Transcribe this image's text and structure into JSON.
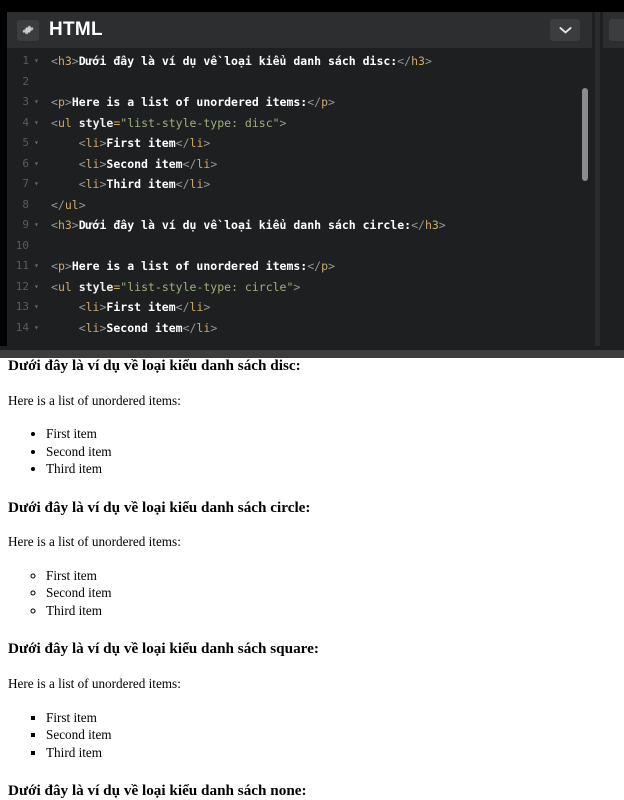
{
  "window": {
    "background": "#000000"
  },
  "editor": {
    "title": "HTML",
    "gear_icon": "gear-icon",
    "collapse_icon": "chevron-down-icon",
    "theme": {
      "header_bg": "#2c2e2f",
      "code_bg": "#1d1f20",
      "tag_color": "#d0a96a",
      "string_color": "#9fb07a",
      "text_color": "#ffffff",
      "punct_color": "#969896",
      "line_number_color": "#5b5c5d"
    },
    "lines": [
      {
        "n": "1",
        "fold": "▾",
        "tokens": [
          {
            "c": "punc",
            "t": "<"
          },
          {
            "c": "tag",
            "t": "h3"
          },
          {
            "c": "punc",
            "t": ">"
          },
          {
            "c": "text",
            "t": "Dưới đây là ví dụ về loại kiểu danh sách disc:"
          },
          {
            "c": "punc",
            "t": "</"
          },
          {
            "c": "tag",
            "t": "h3"
          },
          {
            "c": "punc",
            "t": ">"
          }
        ]
      },
      {
        "n": "2",
        "fold": "",
        "tokens": []
      },
      {
        "n": "3",
        "fold": "▾",
        "tokens": [
          {
            "c": "punc",
            "t": "<"
          },
          {
            "c": "tag",
            "t": "p"
          },
          {
            "c": "punc",
            "t": ">"
          },
          {
            "c": "text",
            "t": "Here is a list of unordered items:"
          },
          {
            "c": "punc",
            "t": "</"
          },
          {
            "c": "tag",
            "t": "p"
          },
          {
            "c": "punc",
            "t": ">"
          }
        ]
      },
      {
        "n": "4",
        "fold": "▾",
        "tokens": [
          {
            "c": "punc",
            "t": "<"
          },
          {
            "c": "tag",
            "t": "ul"
          },
          {
            "c": "punc",
            "t": " "
          },
          {
            "c": "attr",
            "t": "style"
          },
          {
            "c": "eq",
            "t": "="
          },
          {
            "c": "str",
            "t": "\"list-style-type: disc\""
          },
          {
            "c": "punc",
            "t": ">"
          }
        ]
      },
      {
        "n": "5",
        "fold": "▾",
        "tokens": [
          {
            "c": "punc",
            "t": "    <"
          },
          {
            "c": "tag",
            "t": "li"
          },
          {
            "c": "punc",
            "t": ">"
          },
          {
            "c": "text",
            "t": "First item"
          },
          {
            "c": "punc",
            "t": "</"
          },
          {
            "c": "tag",
            "t": "li"
          },
          {
            "c": "punc",
            "t": ">"
          }
        ]
      },
      {
        "n": "6",
        "fold": "▾",
        "tokens": [
          {
            "c": "punc",
            "t": "    <"
          },
          {
            "c": "tag",
            "t": "li"
          },
          {
            "c": "punc",
            "t": ">"
          },
          {
            "c": "text",
            "t": "Second item"
          },
          {
            "c": "punc",
            "t": "</"
          },
          {
            "c": "tag",
            "t": "li"
          },
          {
            "c": "punc",
            "t": ">"
          }
        ]
      },
      {
        "n": "7",
        "fold": "▾",
        "tokens": [
          {
            "c": "punc",
            "t": "    <"
          },
          {
            "c": "tag",
            "t": "li"
          },
          {
            "c": "punc",
            "t": ">"
          },
          {
            "c": "text",
            "t": "Third item"
          },
          {
            "c": "punc",
            "t": "</"
          },
          {
            "c": "tag",
            "t": "li"
          },
          {
            "c": "punc",
            "t": ">"
          }
        ]
      },
      {
        "n": "8",
        "fold": "",
        "tokens": [
          {
            "c": "punc",
            "t": "</"
          },
          {
            "c": "tag",
            "t": "ul"
          },
          {
            "c": "punc",
            "t": ">"
          }
        ]
      },
      {
        "n": "9",
        "fold": "▾",
        "tokens": [
          {
            "c": "punc",
            "t": "<"
          },
          {
            "c": "tag",
            "t": "h3"
          },
          {
            "c": "punc",
            "t": ">"
          },
          {
            "c": "text",
            "t": "Dưới đây là ví dụ về loại kiểu danh sách circle:"
          },
          {
            "c": "punc",
            "t": "</"
          },
          {
            "c": "tag",
            "t": "h3"
          },
          {
            "c": "punc",
            "t": ">"
          }
        ]
      },
      {
        "n": "10",
        "fold": "",
        "tokens": []
      },
      {
        "n": "11",
        "fold": "▾",
        "tokens": [
          {
            "c": "punc",
            "t": "<"
          },
          {
            "c": "tag",
            "t": "p"
          },
          {
            "c": "punc",
            "t": ">"
          },
          {
            "c": "text",
            "t": "Here is a list of unordered items:"
          },
          {
            "c": "punc",
            "t": "</"
          },
          {
            "c": "tag",
            "t": "p"
          },
          {
            "c": "punc",
            "t": ">"
          }
        ]
      },
      {
        "n": "12",
        "fold": "▾",
        "tokens": [
          {
            "c": "punc",
            "t": "<"
          },
          {
            "c": "tag",
            "t": "ul"
          },
          {
            "c": "punc",
            "t": " "
          },
          {
            "c": "attr",
            "t": "style"
          },
          {
            "c": "eq",
            "t": "="
          },
          {
            "c": "str",
            "t": "\"list-style-type: circle\""
          },
          {
            "c": "punc",
            "t": ">"
          }
        ]
      },
      {
        "n": "13",
        "fold": "▾",
        "tokens": [
          {
            "c": "punc",
            "t": "    <"
          },
          {
            "c": "tag",
            "t": "li"
          },
          {
            "c": "punc",
            "t": ">"
          },
          {
            "c": "text",
            "t": "First item"
          },
          {
            "c": "punc",
            "t": "</"
          },
          {
            "c": "tag",
            "t": "li"
          },
          {
            "c": "punc",
            "t": ">"
          }
        ]
      },
      {
        "n": "14",
        "fold": "▾",
        "tokens": [
          {
            "c": "punc",
            "t": "    <"
          },
          {
            "c": "tag",
            "t": "li"
          },
          {
            "c": "punc",
            "t": ">"
          },
          {
            "c": "text",
            "t": "Second item"
          },
          {
            "c": "punc",
            "t": "</"
          },
          {
            "c": "tag",
            "t": "li"
          },
          {
            "c": "punc",
            "t": ">"
          }
        ]
      }
    ]
  },
  "preview": {
    "sections": [
      {
        "heading": "Dưới đây là ví dụ về loại kiểu danh sách disc:",
        "intro": "Here is a list of unordered items:",
        "list_style": "disc",
        "items": [
          "First item",
          "Second item",
          "Third item"
        ]
      },
      {
        "heading": "Dưới đây là ví dụ về loại kiểu danh sách circle:",
        "intro": "Here is a list of unordered items:",
        "list_style": "circle",
        "items": [
          "First item",
          "Second item",
          "Third item"
        ]
      },
      {
        "heading": "Dưới đây là ví dụ về loại kiểu danh sách square:",
        "intro": "Here is a list of unordered items:",
        "list_style": "square",
        "items": [
          "First item",
          "Second item",
          "Third item"
        ]
      },
      {
        "heading": "Dưới đây là ví dụ về loại kiểu danh sách none:",
        "intro": "",
        "list_style": "none",
        "items": []
      }
    ]
  }
}
